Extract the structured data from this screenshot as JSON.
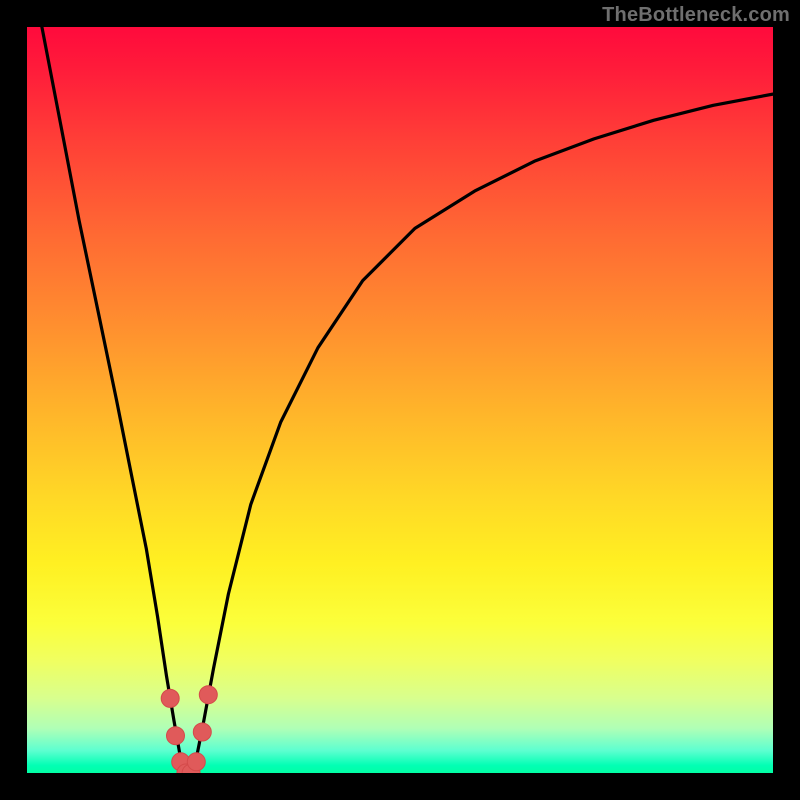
{
  "watermark": {
    "text": "TheBottleneck.com"
  },
  "colors": {
    "page_bg": "#000000",
    "curve_stroke": "#000000",
    "marker_fill": "#e05a5a",
    "marker_stroke": "#d44a4a",
    "gradient_top": "#ff0a3c",
    "gradient_bottom": "#02ffa4",
    "watermark": "#6f6f6f"
  },
  "chart_data": {
    "type": "line",
    "title": "",
    "xlabel": "",
    "ylabel": "",
    "xlim": [
      0,
      100
    ],
    "ylim": [
      0,
      100
    ],
    "grid": false,
    "legend": false,
    "series": [
      {
        "name": "bottleneck-curve",
        "x": [
          2.0,
          4.5,
          7.0,
          9.5,
          12.0,
          14.0,
          16.0,
          17.5,
          18.7,
          19.7,
          20.5,
          21.3,
          22.0,
          22.8,
          23.7,
          25.0,
          27.0,
          30.0,
          34.0,
          39.0,
          45.0,
          52.0,
          60.0,
          68.0,
          76.0,
          84.0,
          92.0,
          100.0
        ],
        "y": [
          100.0,
          87.0,
          74.0,
          62.0,
          50.0,
          40.0,
          30.0,
          21.0,
          13.0,
          7.0,
          2.5,
          0.0,
          0.0,
          2.5,
          7.0,
          14.0,
          24.0,
          36.0,
          47.0,
          57.0,
          66.0,
          73.0,
          78.0,
          82.0,
          85.0,
          87.5,
          89.5,
          91.0
        ]
      }
    ],
    "markers": {
      "name": "highlight-points-near-minimum",
      "x": [
        19.2,
        19.9,
        20.6,
        21.3,
        22.0,
        22.7,
        23.5,
        24.3
      ],
      "y": [
        10.0,
        5.0,
        1.5,
        0.0,
        0.0,
        1.5,
        5.5,
        10.5
      ]
    }
  }
}
